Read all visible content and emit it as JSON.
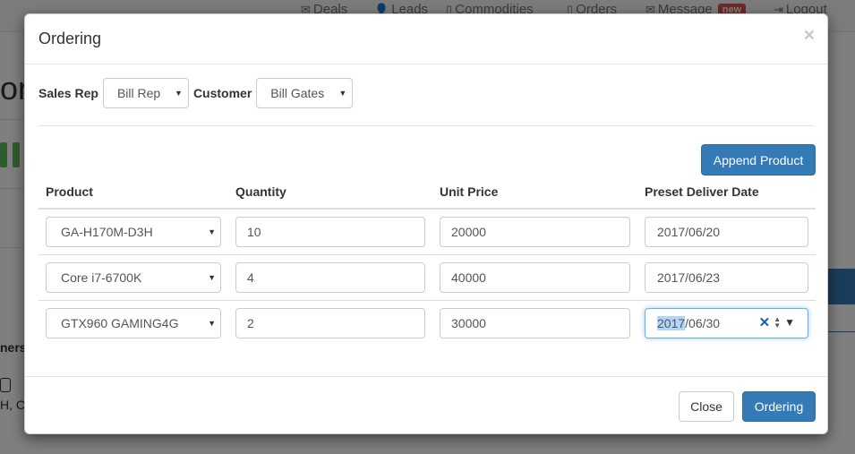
{
  "background": {
    "nav": {
      "deals": "Deals",
      "leads": "Leads",
      "commodities": "Commodities",
      "orders": "Orders",
      "message": "Message",
      "new_badge": "new",
      "logout": "Logout"
    },
    "title_fragment": "or",
    "side_text_1": "ners",
    "side_text_2": "H, C"
  },
  "modal": {
    "title": "Ordering",
    "close_glyph": "×",
    "filters": {
      "sales_rep_label": "Sales Rep",
      "sales_rep_value": "Bill Rep",
      "customer_label": "Customer",
      "customer_value": "Bill Gates"
    },
    "append_button": "Append Product",
    "columns": [
      "Product",
      "Quantity",
      "Unit Price",
      "Preset Deliver Date"
    ],
    "rows": [
      {
        "product": "GA-H170M-D3H",
        "quantity": "10",
        "unit_price": "20000",
        "date": "2017/06/20"
      },
      {
        "product": "Core i7-6700K",
        "quantity": "4",
        "unit_price": "40000",
        "date": "2017/06/23"
      },
      {
        "product": "GTX960 GAMING4G",
        "quantity": "2",
        "unit_price": "30000",
        "date_year": "2017",
        "date_rest": "/06/30"
      }
    ],
    "footer": {
      "close_button": "Close",
      "ordering_button": "Ordering"
    }
  },
  "colors": {
    "primary": "#337ab7",
    "danger_badge": "#d9534f",
    "success": "#5cb85c"
  }
}
